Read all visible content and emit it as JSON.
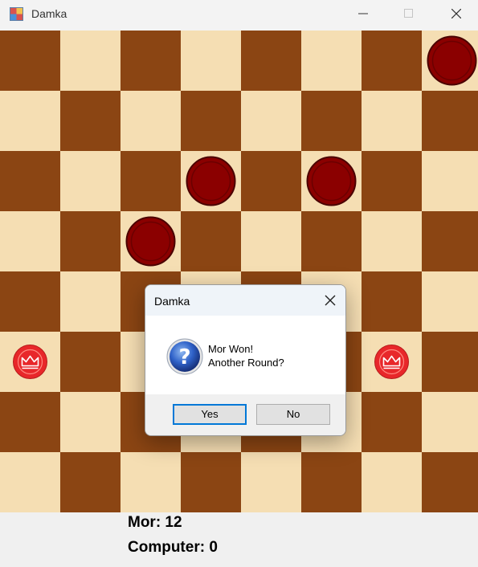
{
  "window": {
    "title": "Damka",
    "icon": "checkerboard-app-icon",
    "controls": [
      "minimize-icon",
      "maximize-icon",
      "close-icon"
    ]
  },
  "board": {
    "size": 8,
    "light_square_color": "#f5deb3",
    "dark_square_color": "#8b4513",
    "pieces": [
      {
        "row": 0,
        "col": 7,
        "color": "#8b0000",
        "type": "man"
      },
      {
        "row": 2,
        "col": 3,
        "color": "#8b0000",
        "type": "man"
      },
      {
        "row": 2,
        "col": 5,
        "color": "#8b0000",
        "type": "man"
      },
      {
        "row": 3,
        "col": 2,
        "color": "#8b0000",
        "type": "man"
      },
      {
        "row": 5,
        "col": 0,
        "color": "#e8272a",
        "type": "king"
      },
      {
        "row": 5,
        "col": 6,
        "color": "#e8272a",
        "type": "king"
      }
    ]
  },
  "scores": {
    "player1": "Mor: 12",
    "player2": "Computer: 0"
  },
  "dialog": {
    "title": "Damka",
    "icon": "question-icon",
    "message_line1": "Mor Won!",
    "message_line2": "Another Round?",
    "yes_label": "Yes",
    "no_label": "No"
  }
}
